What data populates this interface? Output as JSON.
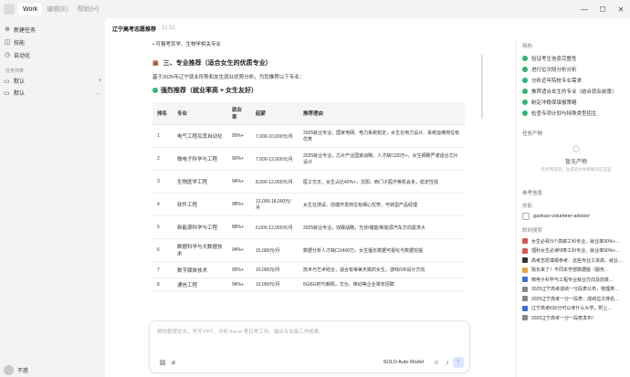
{
  "window": {
    "tabs": [
      {
        "label": "Work"
      },
      {
        "label": "编辑(E)"
      },
      {
        "label": "帮助(H)"
      }
    ],
    "controls": [
      "—",
      "☐",
      "✕"
    ]
  },
  "sidebar": {
    "items": [
      {
        "icon": "plus-icon",
        "label": "新建任务"
      },
      {
        "icon": "skill-icon",
        "label": "技能"
      },
      {
        "icon": "automation-icon",
        "label": "自动化"
      }
    ],
    "section_label": "任务列表",
    "folders": [
      {
        "label": "默认",
        "action": "+"
      },
      {
        "label": "默认",
        "action": "…"
      }
    ],
    "user": {
      "name": "不惑"
    }
  },
  "chat": {
    "title": "辽宁高考志愿推荐",
    "time": "21:51",
    "top_line": "• 可报考农学、生物学相关专业",
    "section_title": "三、专业推荐（适合女生的优质专业）",
    "intro": "基于2025年辽宁就业形势和女生就业优势分析，为您推荐以下专业：",
    "subtitle": "强烈推荐（就业率高 + 女生友好）",
    "table": {
      "headers": [
        "排名",
        "专业",
        "就业率",
        "起薪",
        "推荐理由"
      ],
      "rows": [
        {
          "rank": "1",
          "major": "电气工程及其自动化",
          "rate": "90%+",
          "salary": "7,000-10,000元/月",
          "reason": "2025就业专业，国家电网、电力系统稳定，女生在电力设计、系统运维岗位有优势"
        },
        {
          "rank": "2",
          "major": "微电子科学与工程",
          "rate": "90%+",
          "salary": "7,000-12,000元/月",
          "reason": "2025就业专业，芯片产业国家战略，人才缺口30万+，女生细致严谨适合芯片设计"
        },
        {
          "rank": "3",
          "major": "生物医学工程",
          "rate": "94%+",
          "salary": "8,000-12,000元/月",
          "reason": "医工交叉，女生占比40%+，沈阳、西门子医疗等机会多，稳定性强"
        },
        {
          "rank": "4",
          "major": "软件工程",
          "rate": "98%+",
          "salary": "12,000-18,000元/月",
          "reason": "女生在测试、前端开发岗位有细心优势，可转型产品经理"
        },
        {
          "rank": "5",
          "major": "新能源科学与工程",
          "rate": "88%+",
          "salary": "6,000-12,000元/月",
          "reason": "2025就业专业，双碳战略，光伏/储能/新能源汽车方向需求大"
        },
        {
          "rank": "6",
          "major": "数据科学与大数据技术",
          "rate": "94%+",
          "salary": "15,000元/月",
          "reason": "数据分析人才缺口1400万，女生擅长数据可视化与数据挖掘"
        },
        {
          "rank": "7",
          "major": "数字媒体技术",
          "rate": "95%+",
          "salary": "10,000元/月",
          "reason": "技术与艺术结合，适合有审美天赋的女生，游戏/VR设计方向"
        },
        {
          "rank": "8",
          "major": "通信工程",
          "rate": "94%+",
          "salary": "10,000元/月",
          "reason": "5G/6G时代朝阳，华为、移动等企业常年招聘"
        }
      ]
    }
  },
  "composer": {
    "placeholder": "帮你整理论文，写写 PPT，分析 Excel 等日常工作，输出专业级工作成果。",
    "model": "SOLO Auto Model",
    "send": "↑"
  },
  "right_panel": {
    "steps_title": "待办",
    "steps": [
      "验证考生信息完整性",
      "进行位次段分析分析",
      "分析近年院校专业需求",
      "推荐适合女生的专业（结合就业前景）",
      "制定冲稳保填报策略",
      "检查专项计划与特殊类型招生"
    ],
    "output_title": "任务产物",
    "empty_title": "暂无产物",
    "empty_desc": "任务完成后，生成的文件将展示在这里",
    "ref_title": "参考信息",
    "skills_label": "技能",
    "skill": "gaokao-volunteer-advisor",
    "links_label": "联网搜索",
    "links": [
      "女生必看!5个高薪工科专业，就业率90%+…",
      "理科女生必读!8类工科专业，就业率90%+…",
      "高考志愿填报参考：这些专业工资高、就业…",
      "院长来了！不同本学部数据版（服务…",
      "微电子科学与工程专业就业方向及前景…",
      "2025辽宁高考成绩一分段表公布，物理类…",
      "2025辽宁高考一分一段表：成绩位次排名…",
      "辽宁高考630分可以考什么大学，附上…",
      "2025辽宁高考一分一段表发布！"
    ]
  }
}
